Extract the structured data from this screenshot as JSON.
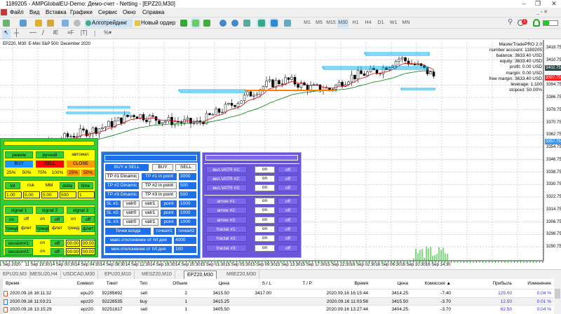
{
  "window": {
    "title": "1189205 - AMPGlobalEU-Demo: Демо-счет - Netting - [EPZ20,M30]"
  },
  "menu": [
    "Файл",
    "Вид",
    "Вставка",
    "Графики",
    "Сервис",
    "Окно",
    "Справка"
  ],
  "toolbar": {
    "algo_label": "Алготрейдинг",
    "new_order_label": "Новый ордер",
    "notification_count": "1",
    "timeframes": [
      "M1",
      "M5",
      "M15",
      "M30",
      "H1",
      "H4",
      "D1",
      "W1",
      "MN"
    ],
    "active_timeframe": "M30"
  },
  "chart": {
    "label": "EPZ20, M30:  E-Mini S&P 500: December 2020",
    "price_ticks": [
      "3418.75",
      "3410.75",
      "3394.75",
      "3386.75",
      "3378.75",
      "3370.75",
      "3362.75",
      "3354.75",
      "3346.75",
      "3338.75",
      "3330.75",
      "3322.75",
      "3314.75",
      "3306.75",
      "3298.75",
      "3290.75"
    ],
    "current_price": "3402.75",
    "red_price": "3397.75",
    "blue_price": "3357.75",
    "time_ticks": [
      "11 Sep 2020",
      "11 Sep 19:30",
      "14 Sep 00:30",
      "14 Sep 04:30",
      "14 Sep 08:30",
      "14 Sep 12:30",
      "14 Sep 16:30",
      "14 Sep 20:30",
      "15 Sep 01:30",
      "15 Sep 05:30",
      "15 Sep 09:30",
      "15 Sep 13:30",
      "15 Sep 17:30",
      "15 Sep 22:30",
      "16 Sep 02:30",
      "16 Sep 06:30",
      "16 Sep 10:30",
      "16 Sep 14:30"
    ],
    "colors": {
      "bull": "#ffffff",
      "bear": "#000000",
      "ma_fast": "#e00000",
      "ma_slow": "#008000",
      "level": "#00b0f0",
      "level_alt": "#ff8000",
      "volume": "#00c000"
    }
  },
  "account": [
    "MasterTradePRO 2.0",
    "number account: 1189205",
    "balance: 3633.40 USD",
    "equity: 3633.40 USD",
    "profit: 0.00 USD",
    "margin: 0.00 USD",
    "free margin: 3633.40 USD",
    "leverage: 1:100",
    "stopout: 50.00%"
  ],
  "green_panel": {
    "mode": [
      "режим",
      "ручной",
      "автомат."
    ],
    "actions": [
      "BUY",
      "SELL",
      "CLOSE"
    ],
    "percents": [
      "25%",
      "50%",
      "75%",
      "100%",
      "25%",
      "50%"
    ],
    "params_labels": [
      "lot",
      "risk",
      "MM",
      "delta",
      "time"
    ],
    "params_values": [
      "1.00",
      "5.00",
      "5.00",
      "500",
      "1"
    ],
    "signals": [
      "signal 1",
      "signal 2",
      "signal 3"
    ],
    "onoff": [
      "on",
      "off",
      "on",
      "off",
      "on",
      "off"
    ],
    "trend": [
      "тренд",
      "флет",
      "тренд",
      "флет",
      "тренд",
      "флет"
    ],
    "sessions": [
      {
        "label": "session#1:",
        "on": "on",
        "off": "off",
        "from": "00:00",
        "to": "00:00"
      },
      {
        "label": "session#2:",
        "on": "on",
        "off": "off",
        "from": "00:00",
        "to": "00:00"
      }
    ]
  },
  "blue_panel": {
    "direction": [
      "BUY и SELL",
      "BUY",
      "SELL"
    ],
    "tp": [
      {
        "dyn": "TP #1 Dinamic",
        "pt": "TP #1 in point",
        "val": "3000"
      },
      {
        "dyn": "TP #2 Dinamic",
        "pt": "TP #2 in point",
        "val": "500"
      },
      {
        "dyn": "TP #3 Dinamic",
        "pt": "TP #3 in point",
        "val": "500"
      }
    ],
    "sl": [
      {
        "label": "SL #1:",
        "v0": "vatr0",
        "v1": "vatr1",
        "pt": "point",
        "val": "1000"
      },
      {
        "label": "SL #2:",
        "v0": "vatr0",
        "v1": "vatr1",
        "pt": "point",
        "val": "1000"
      },
      {
        "label": "SL #3:",
        "v0": "vatr0",
        "v1": "vatr1",
        "pt": "point",
        "val": "1000"
      }
    ],
    "entry": [
      "Точки входа",
      "точка#1",
      "точка#2"
    ],
    "max_dev": {
      "label": "макс.отклонение от h/l дня",
      "val": "4000"
    },
    "min_dev": {
      "label": "мин.отклонение от h/l дня",
      "val": "100"
    }
  },
  "purple_panel": {
    "rows": [
      {
        "label": "вкл.VATR #1:",
        "on": "on",
        "off": "off"
      },
      {
        "label": "вкл.VATR #2:",
        "on": "on",
        "off": "off"
      },
      {
        "label": "вкл.VATR #3:",
        "on": "on",
        "off": "off"
      },
      {
        "label": "arrow #1:",
        "on": "on",
        "off": "off"
      },
      {
        "label": "arrow #2:",
        "on": "on",
        "off": "off"
      },
      {
        "label": "arrow #3:",
        "on": "on",
        "off": "off"
      },
      {
        "label": "fractal #1:",
        "on": "on",
        "off": "off"
      },
      {
        "label": "fractal #2:",
        "on": "on",
        "off": "off"
      },
      {
        "label": "fractal #3:",
        "on": "on",
        "off": "off"
      }
    ]
  },
  "tabs": [
    "EPU20,M3",
    "MESU20,H4",
    "USDCAD,M30",
    "EPU20,M10",
    "MESZ20,M10",
    "EPZ20,M30",
    "M6EZ20,M30"
  ],
  "active_tab": "EPZ20,M30",
  "table": {
    "headers": [
      "Время",
      "Символ",
      "Тикет",
      "Тип",
      "Объем",
      "Цена",
      "S / L",
      "T / P",
      "Время",
      "Цена",
      "Комиссия ▲",
      "Прибыль",
      "Изменение"
    ],
    "rows": [
      [
        "2020.09.16 16:11:32",
        "epu20",
        "92285692",
        "sell",
        "2",
        "3415.50",
        "3417.00",
        "",
        "2020.09.16 16:15:44",
        "3414.25",
        "-7.40",
        "125.00",
        "0.04 %"
      ],
      [
        "2020.09.16 11:03:21",
        "epz20",
        "92228535",
        "buy",
        "1",
        "3415.25",
        "",
        "",
        "2020.09.16 11:03:56",
        "3415.50",
        "-3.70",
        "12.50",
        "0.01 %"
      ],
      [
        "2020.09.16 13:15:29",
        "epz20",
        "92251817",
        "sell",
        "1",
        "3405.50",
        "",
        "",
        "2020.09.16 13:27:44",
        "3404.25",
        "-3.70",
        "62.50",
        "0.04 %"
      ]
    ]
  }
}
